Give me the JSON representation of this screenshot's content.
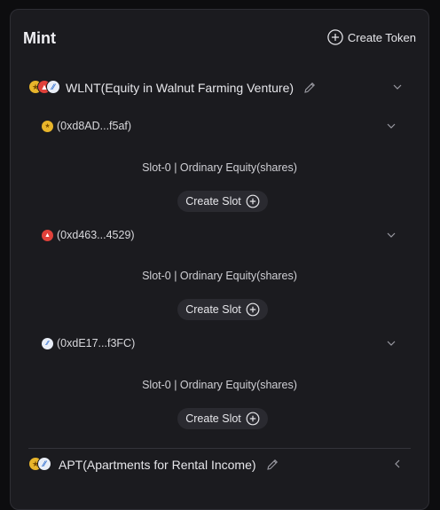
{
  "header": {
    "title": "Mint",
    "create_token_label": "Create Token"
  },
  "tokens": [
    {
      "name": "WLNT(Equity in Walnut Farming Venture)",
      "expanded": true,
      "chains": [
        {
          "address": "(0xd8AD...f5af)",
          "icon": "gold-coin-icon",
          "slot": "Slot-0 | Ordinary Equity(shares)",
          "button": "Create Slot"
        },
        {
          "address": "(0xd463...4529)",
          "icon": "red-triangle-coin-icon",
          "slot": "Slot-0 | Ordinary Equity(shares)",
          "button": "Create Slot"
        },
        {
          "address": "(0xdE17...f3FC)",
          "icon": "blue-stripe-coin-icon",
          "slot": "Slot-0 | Ordinary Equity(shares)",
          "button": "Create Slot"
        }
      ]
    },
    {
      "name": "APT(Apartments for Rental Income)",
      "expanded": false
    }
  ],
  "colors": {
    "gold": "#e8b52b",
    "red": "#e0413a",
    "blue": "#2f6fd1",
    "panel": "#1b1b1f"
  }
}
